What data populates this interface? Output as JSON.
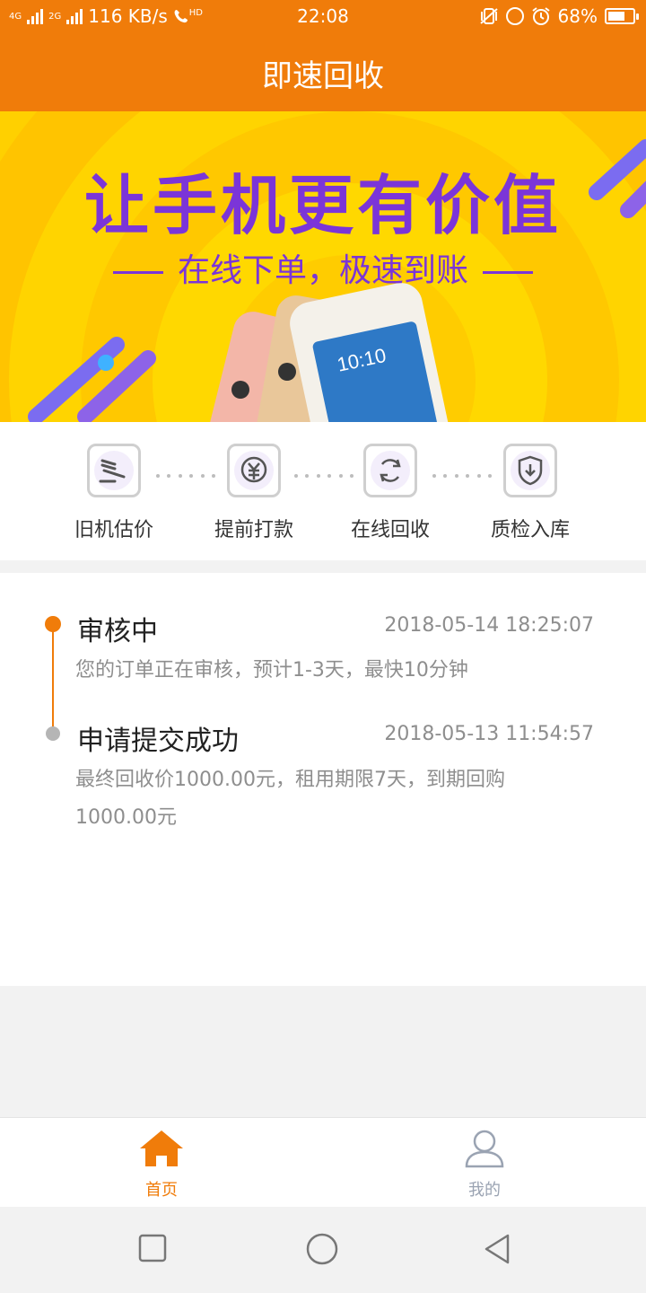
{
  "status_bar": {
    "net_left": "4G",
    "net_right": "2G",
    "speed": "116 KB/s",
    "hd": "HD",
    "time": "22:08",
    "battery": "68%",
    "battery_level": 0.68
  },
  "app": {
    "title": "即速回收"
  },
  "banner": {
    "headline": "让手机更有价值",
    "subline": "在线下单，极速到账",
    "phone_time": "10:10"
  },
  "steps": [
    {
      "label": "旧机估价",
      "icon": "gavel-icon"
    },
    {
      "label": "提前打款",
      "icon": "yuan-coin-icon"
    },
    {
      "label": "在线回收",
      "icon": "recycle-icon"
    },
    {
      "label": "质检入库",
      "icon": "shield-download-icon"
    }
  ],
  "timeline": [
    {
      "title": "审核中",
      "time": "2018-05-14 18:25:07",
      "desc": "您的订单正在审核，预计1-3天，最快10分钟",
      "active": true
    },
    {
      "title": "申请提交成功",
      "time": "2018-05-13 11:54:57",
      "desc": "最终回收价1000.00元，租用期限7天，到期回购1000.00元",
      "active": false
    }
  ],
  "bottom_nav": [
    {
      "label": "首页",
      "icon": "home-icon",
      "active": true
    },
    {
      "label": "我的",
      "icon": "user-icon",
      "active": false
    }
  ],
  "colors": {
    "accent": "#f07c0a",
    "banner_yellow": "#ffd000",
    "banner_purple": "#7b35d8",
    "muted_text": "#8e8e8e",
    "inactive_nav": "#9aa3b2"
  }
}
